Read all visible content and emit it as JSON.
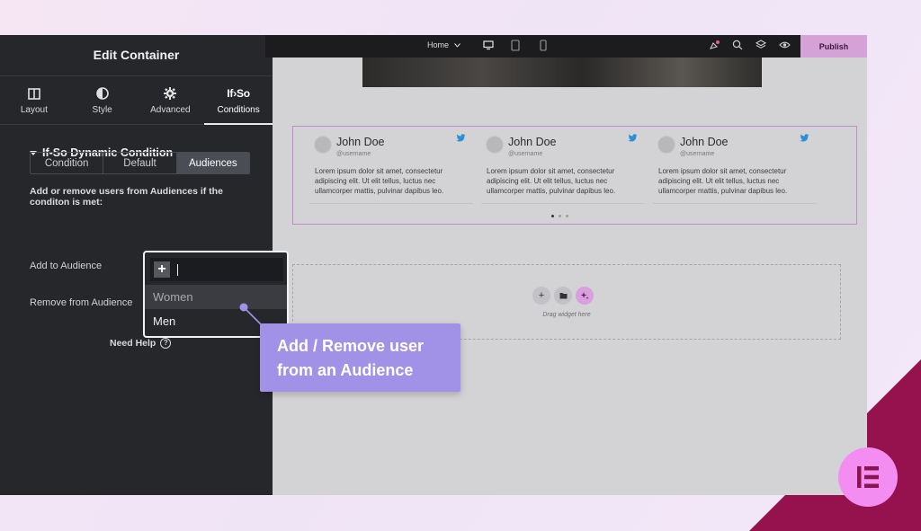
{
  "colors": {
    "panel_bg": "#26272b",
    "publish_bg": "#d5a2d8",
    "callout_bg": "#a191e7",
    "accent_corner": "#96124f",
    "badge_bg": "#f38df1",
    "twitter_blue": "#2a8fd6"
  },
  "panel": {
    "title": "Edit Container",
    "tabs": [
      {
        "label": "Layout",
        "icon": "columns-icon"
      },
      {
        "label": "Style",
        "icon": "half-circle-icon"
      },
      {
        "label": "Advanced",
        "icon": "gear-icon"
      },
      {
        "label": "Conditions",
        "icon": "ifso-logo",
        "logo_text": "If›So"
      }
    ],
    "section_title": "If-So Dynamic Condition",
    "segments": [
      "Condition",
      "Default",
      "Audiences"
    ],
    "active_segment": "Audiences",
    "description": "Add or remove users from Audiences if the conditon is met:",
    "add_label": "Add to Audience",
    "remove_label": "Remove from Audience",
    "help_label": "Need Help"
  },
  "dropdown": {
    "add_symbol": "+",
    "options": [
      "Women",
      "Men"
    ],
    "highlighted": "Women"
  },
  "topbar": {
    "page_select": "Home",
    "publish_label": "Publish"
  },
  "canvas": {
    "cards": [
      {
        "name": "John Doe",
        "handle": "@username",
        "text": "Lorem ipsum dolor sit amet, consectetur adipiscing elit. Ut elit tellus, luctus nec ullamcorper mattis, pulvinar dapibus leo."
      },
      {
        "name": "John Doe",
        "handle": "@username",
        "text": "Lorem ipsum dolor sit amet, consectetur adipiscing elit. Ut elit tellus, luctus nec ullamcorper mattis, pulvinar dapibus leo."
      },
      {
        "name": "John Doe",
        "handle": "@username",
        "text": "Lorem ipsum dolor sit amet, consectetur adipiscing elit. Ut elit tellus, luctus nec ullamcorper mattis, pulvinar dapibus leo."
      }
    ],
    "drop_label": "Drag widget here"
  },
  "callout": {
    "line1": "Add / Remove user",
    "line2": "from an Audience"
  }
}
